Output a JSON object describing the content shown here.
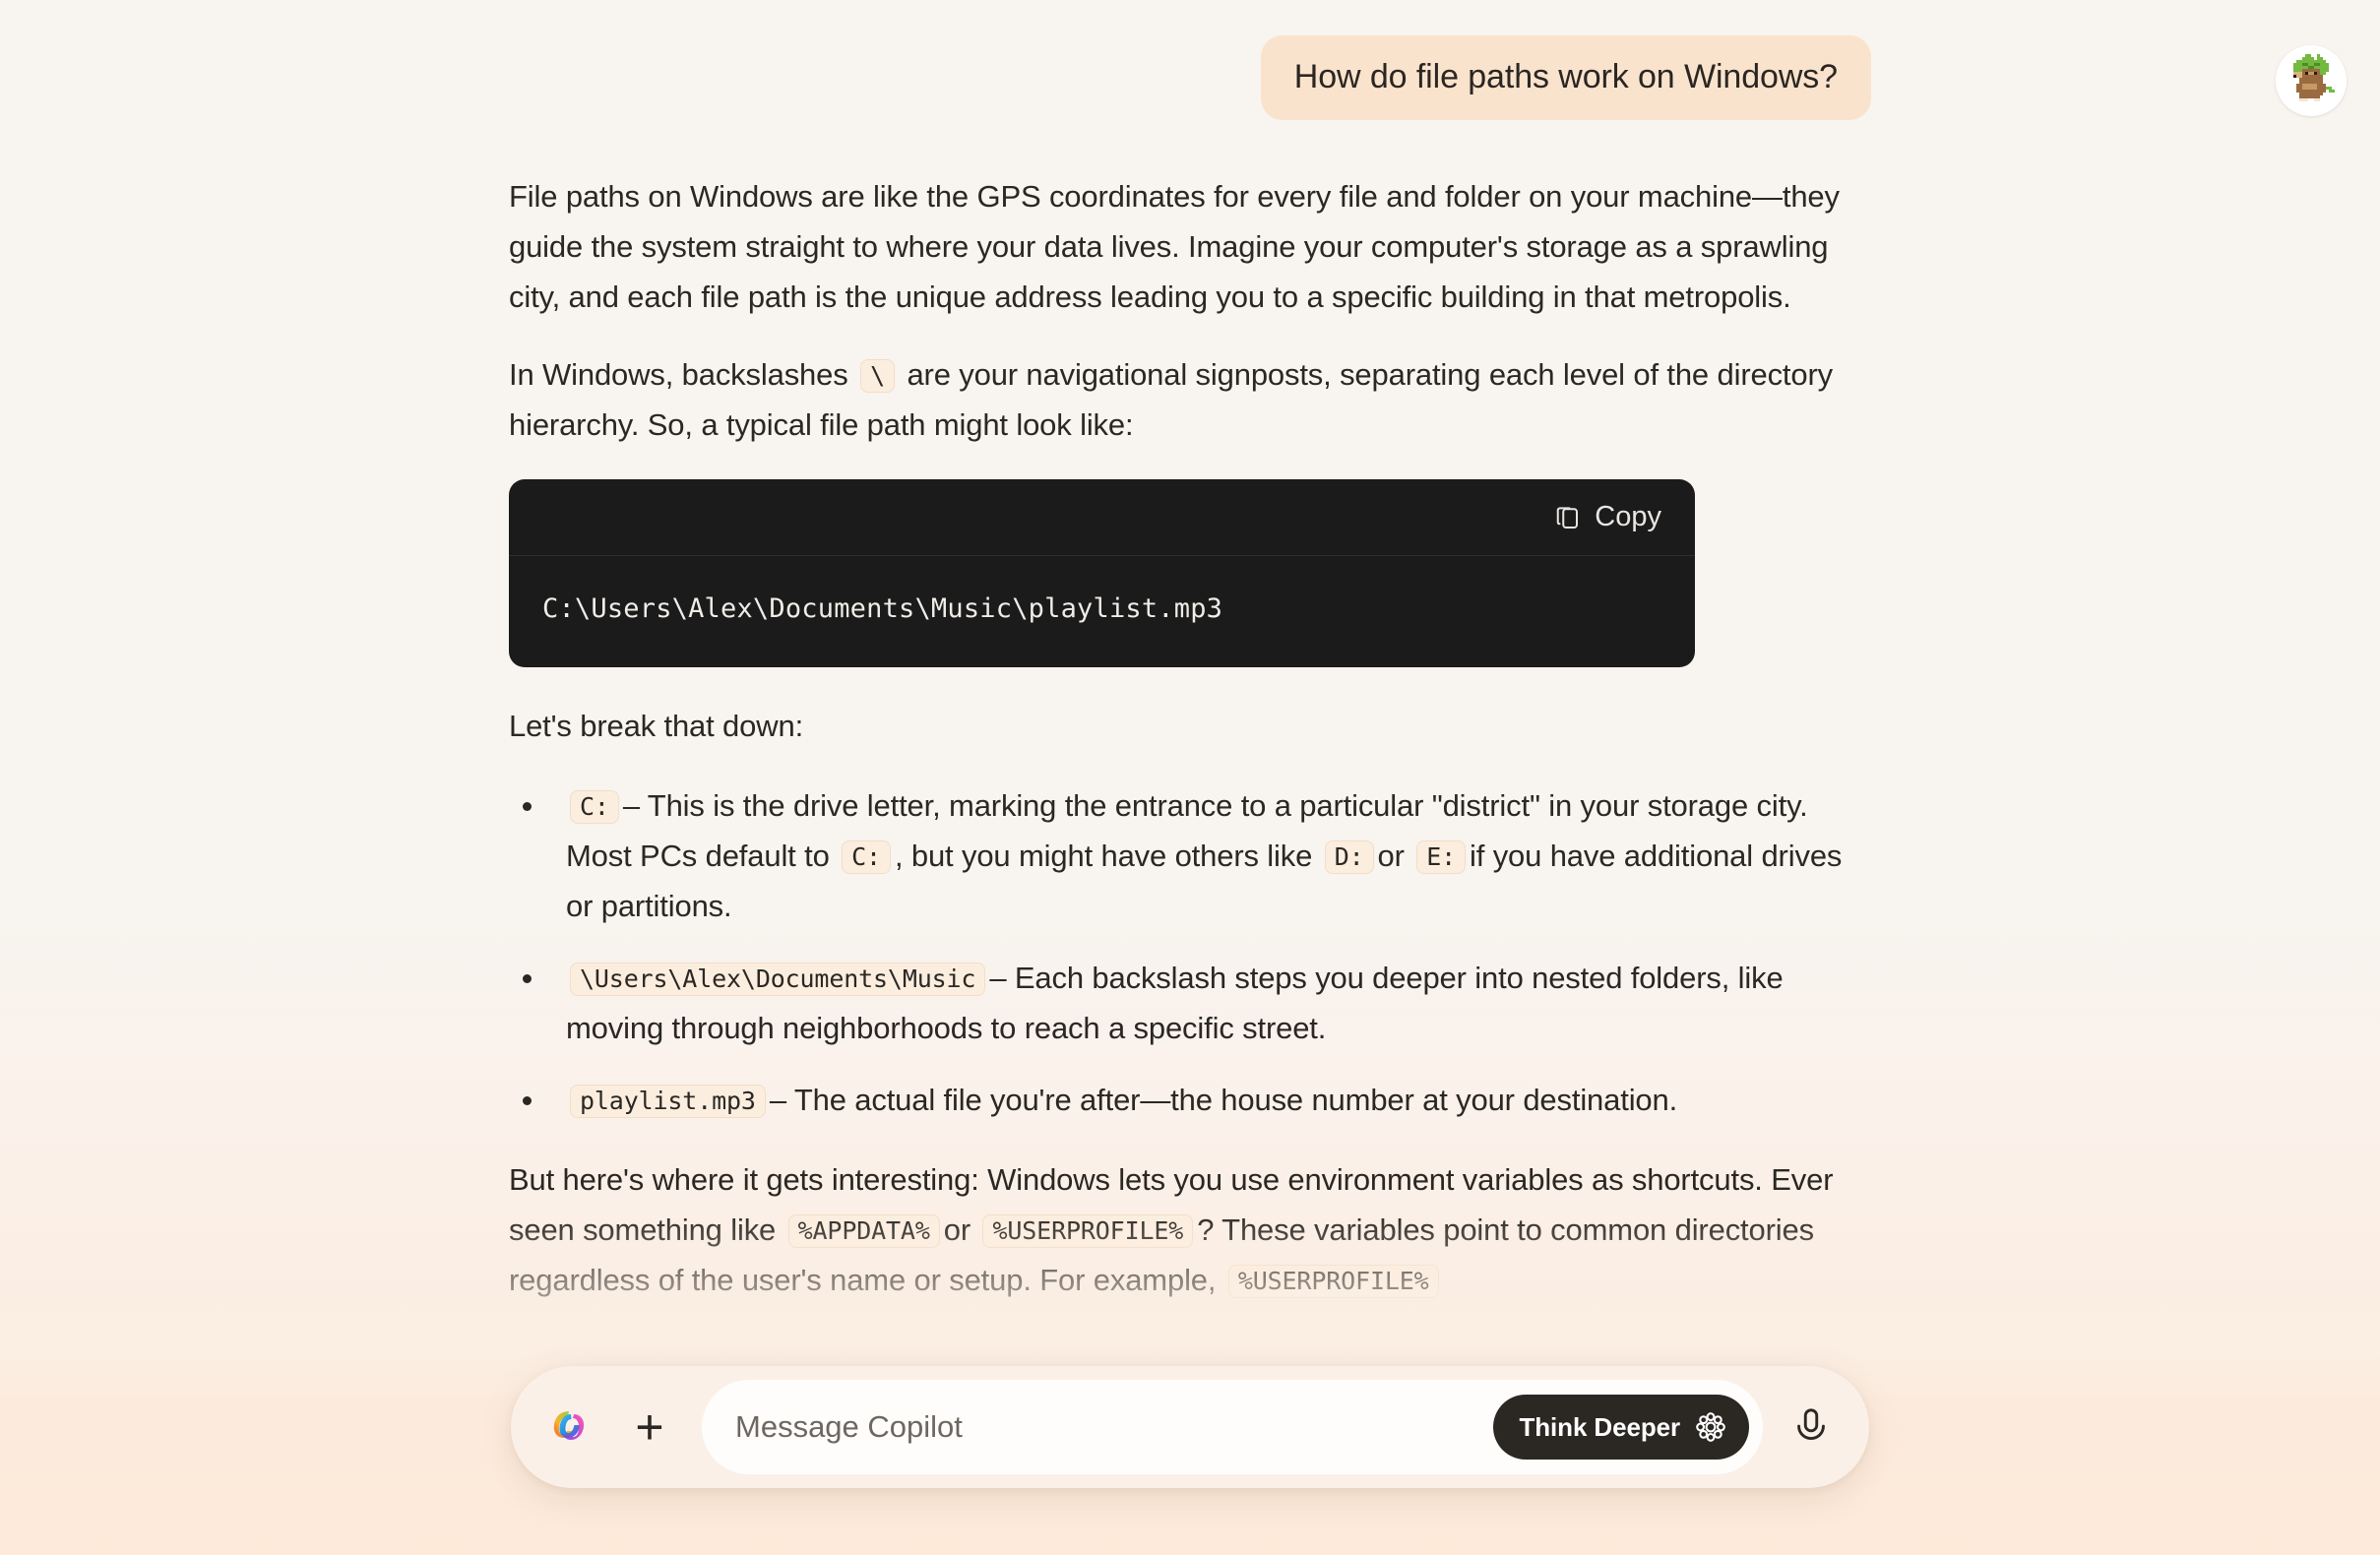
{
  "app": {
    "name": "Copilot",
    "accent_dark": "#2b2723",
    "bubble_bg": "#fae3cd",
    "chip_bg": "#fceedf",
    "code_bg": "#1b1b1b",
    "page_bg_top": "#f8f4ef",
    "page_bg_bottom": "#fdead9"
  },
  "avatar": {
    "icon": "pixel-art-creature-avatar",
    "alt": "Pixel art avatar of a small brown creature with a green leafy head"
  },
  "conversation": {
    "user_message": "How do file paths work on Windows?",
    "assistant": {
      "paragraph_1": "File paths on Windows are like the GPS coordinates for every file and folder on your machine—they guide the system straight to where your data lives. Imagine your computer's storage as a sprawling city, and each file path is the unique address leading you to a specific building in that metropolis.",
      "paragraph_2_part_a": "In Windows, backslashes",
      "paragraph_2_code": "\\",
      "paragraph_2_part_b": "are your navigational signposts, separating each level of the directory hierarchy. So, a typical file path might look like:",
      "codeblock": {
        "copy_label": "Copy",
        "copy_icon": "copy-icon",
        "content": "C:\\Users\\Alex\\Documents\\Music\\playlist.mp3"
      },
      "breakdown_intro": "Let's break that down:",
      "bullets": [
        {
          "code_1": "C:",
          "text_1": "– This is the drive letter, marking the entrance to a particular \"district\" in your storage city. Most PCs default to",
          "code_2": "C:",
          "text_2": ", but you might have others like",
          "code_3": "D:",
          "text_3": "or",
          "code_4": "E:",
          "text_4": "if you have additional drives or partitions."
        },
        {
          "code_1": "\\Users\\Alex\\Documents\\Music",
          "text_1": "– Each backslash steps you deeper into nested folders, like moving through neighborhoods to reach a specific street."
        },
        {
          "code_1": "playlist.mp3",
          "text_1": "– The actual file you're after—the house number at your destination."
        }
      ],
      "paragraph_3_part_a": "But here's where it gets interesting: Windows lets you use environment variables as shortcuts. Ever seen something like",
      "paragraph_3_code_1": "%APPDATA%",
      "paragraph_3_part_b": "or",
      "paragraph_3_code_2": "%USERPROFILE%",
      "paragraph_3_part_c": "? These variables point to common directories regardless of the user's name or setup. For example,",
      "paragraph_3_code_3": "%USERPROFILE%"
    }
  },
  "composer": {
    "logo_icon": "copilot-logo-icon",
    "add_icon": "plus-icon",
    "add_label": "+",
    "input_placeholder": "Message Copilot",
    "input_value": "",
    "think_deeper_label": "Think Deeper",
    "think_deeper_icon": "rosette-icon",
    "mic_icon": "microphone-icon"
  }
}
